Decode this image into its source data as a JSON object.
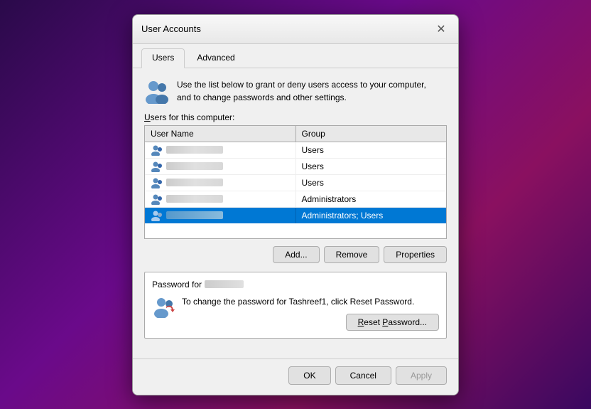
{
  "dialog": {
    "title": "User Accounts",
    "close_label": "✕"
  },
  "tabs": [
    {
      "id": "users",
      "label": "Users",
      "active": true
    },
    {
      "id": "advanced",
      "label": "Advanced",
      "active": false
    }
  ],
  "info": {
    "text": "Use the list below to grant or deny users access to your computer,\nand to change passwords and other settings."
  },
  "users_section": {
    "label": "Users for this computer:",
    "columns": {
      "name": "User Name",
      "group": "Group"
    },
    "rows": [
      {
        "group": "Users",
        "selected": false
      },
      {
        "group": "Users",
        "selected": false
      },
      {
        "group": "Users",
        "selected": false
      },
      {
        "group": "Administrators",
        "selected": false
      },
      {
        "group": "Administrators; Users",
        "selected": true
      }
    ],
    "buttons": {
      "add": "Add...",
      "remove": "Remove",
      "properties": "Properties"
    }
  },
  "password_section": {
    "label_prefix": "Password for",
    "text": "To change the password for Tashreef1, click Reset Password.",
    "reset_btn": "Reset Password..."
  },
  "footer": {
    "ok": "OK",
    "cancel": "Cancel",
    "apply": "Apply"
  }
}
